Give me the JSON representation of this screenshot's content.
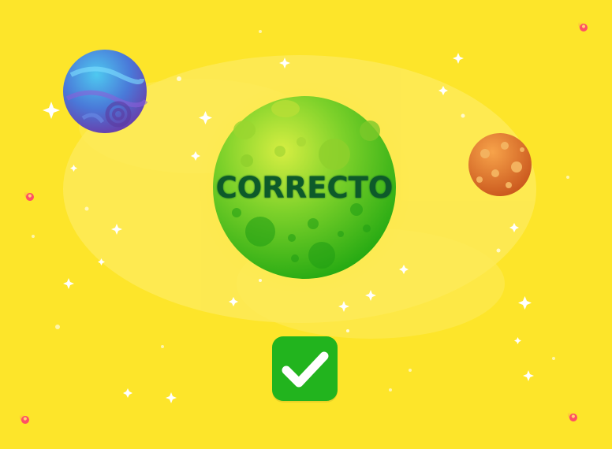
{
  "result": {
    "label": "CORRECTO"
  },
  "icons": {
    "confirm": "checkmark-icon"
  },
  "colors": {
    "background": "#fde52a",
    "planet_green": "#46c21f",
    "planet_blue": "#3f8de0",
    "planet_orange": "#e27a26",
    "button": "#22b41e",
    "label_text": "#0d5a2a"
  }
}
